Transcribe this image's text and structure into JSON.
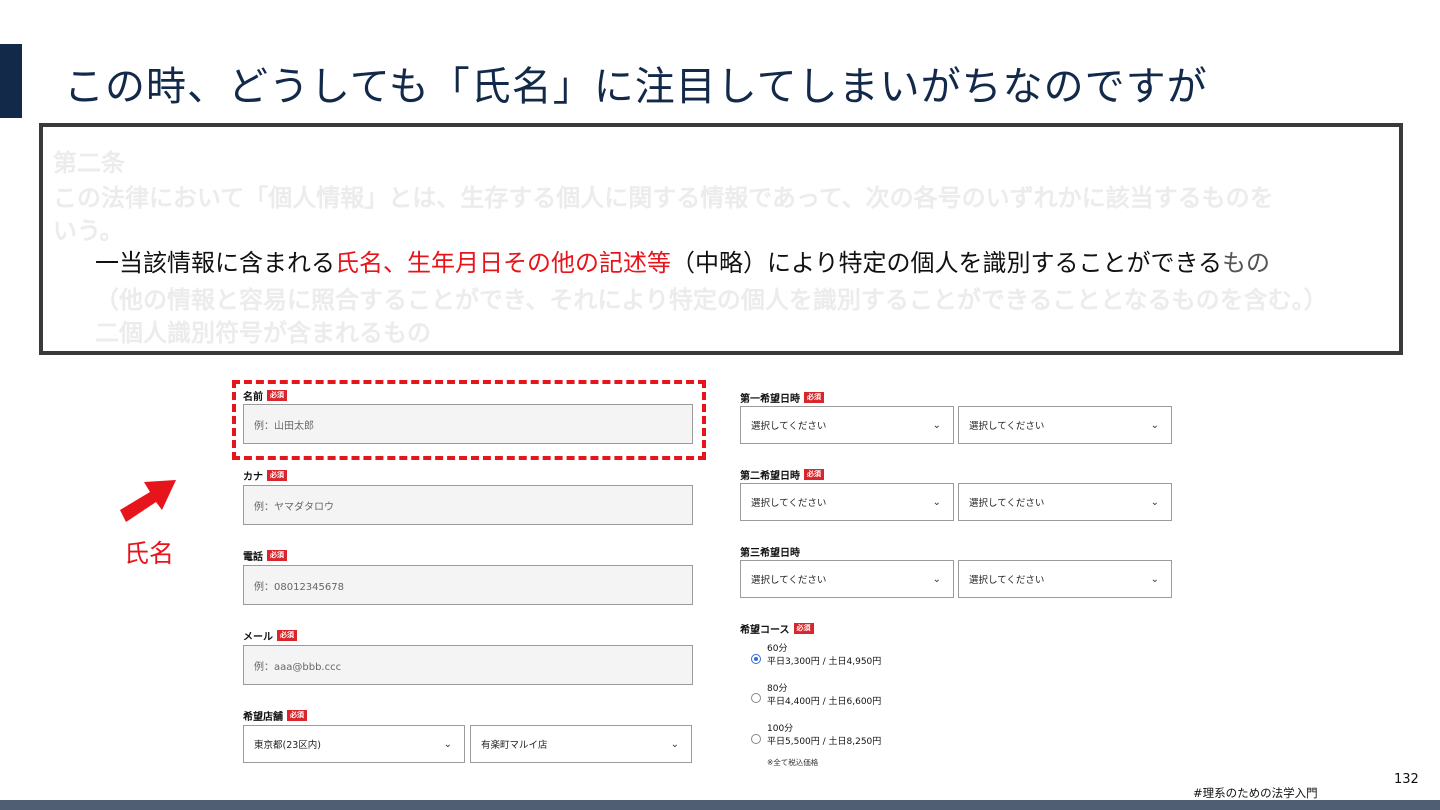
{
  "slide": {
    "title": "この時、どうしても「氏名」に注目してしまいがちなのですが",
    "page_number": "132",
    "footer_tag": "#理系のための法学入門"
  },
  "law": {
    "article": "第二条",
    "para_line1": "この法律において「個人情報」とは、生存する個人に関する情報であって、次の各号のいずれかに該当するものを",
    "para_line2": "いう。",
    "item1_prefix": "一当該情報に含まれる",
    "item1_red": "氏名、生年月日その他の記述等",
    "item1_mid": "（中略）により特定の個人を識別することができる",
    "item1_end": "もの",
    "item1_cont": "（他の情報と容易に照合することができ、それにより特定の個人を識別することができることとなるものを含む。）",
    "item2": "二個人識別符号が含まれるもの"
  },
  "callout": {
    "label": "氏名"
  },
  "form": {
    "required_badge": "必須",
    "name": {
      "label": "名前",
      "placeholder": "例：山田太郎"
    },
    "kana": {
      "label": "カナ",
      "placeholder": "例：ヤマダタロウ"
    },
    "phone": {
      "label": "電話",
      "placeholder": "例：08012345678"
    },
    "email": {
      "label": "メール",
      "placeholder": "例：aaa@bbb.ccc"
    },
    "store": {
      "label": "希望店舗",
      "region": "東京都(23区内)",
      "branch": "有楽町マルイ店"
    },
    "date1": {
      "label": "第一希望日時",
      "date": "選択してください",
      "time": "選択してください"
    },
    "date2": {
      "label": "第二希望日時",
      "date": "選択してください",
      "time": "選択してください"
    },
    "date3": {
      "label": "第三希望日時",
      "date": "選択してください",
      "time": "選択してください"
    },
    "course": {
      "label": "希望コース",
      "options": [
        {
          "duration": "60分",
          "price": "平日3,300円 / 土日4,950円",
          "checked": true
        },
        {
          "duration": "80分",
          "price": "平日4,400円 / 土日6,600円",
          "checked": false
        },
        {
          "duration": "100分",
          "price": "平日5,500円 / 土日8,250円",
          "checked": false
        }
      ],
      "note": "※全て税込価格"
    }
  },
  "icons": {
    "chevron": "⌄"
  },
  "colors": {
    "navy": "#12294a",
    "red": "#e8141b",
    "required": "#d9262c",
    "radio": "#2b6ed8"
  }
}
